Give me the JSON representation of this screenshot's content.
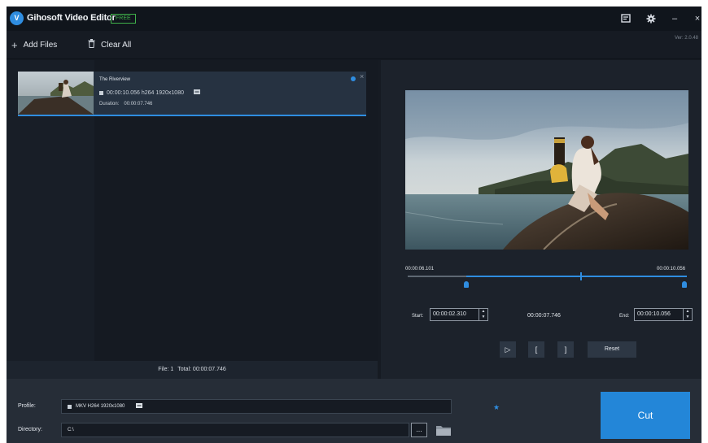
{
  "app": {
    "logo_letter": "V",
    "title": "Gihosoft Video Editor",
    "badge": "FREE",
    "version": "Ver: 2.0.48"
  },
  "window_controls": {
    "icons": [
      "feedback-icon",
      "settings-gear-icon",
      "minimize-icon",
      "close-icon"
    ],
    "minimize": "–",
    "close": "×"
  },
  "toolbar": {
    "add_files_label": "Add Files",
    "add_files_icon": "plus-icon",
    "clear_all_label": "Clear All",
    "clear_all_icon": "trash-icon"
  },
  "files": [
    {
      "name": "The Riverview",
      "info": "00:00:10.056 h264 1920x1080",
      "duration_label": "Duration:",
      "duration": "00:00:07.746"
    }
  ],
  "file_status": {
    "count": "File: 1",
    "total": "Total: 00:00:07.746"
  },
  "timeline": {
    "start_time": "00:00:06.101",
    "end_time": "00:00:10.056",
    "selection_start_fraction": 0.21,
    "selection_end_fraction": 1.0,
    "playhead_fraction": 0.62
  },
  "trim": {
    "start_label": "Start:",
    "start_value": "00:00:02.310",
    "duration": "00:00:07.746",
    "end_label": "End:",
    "end_value": "00:00:10.056",
    "spin_up": "▲",
    "spin_down": "▼"
  },
  "controls": {
    "play": "▷",
    "mark_in": "[",
    "mark_out": "]",
    "reset": "Reset"
  },
  "output": {
    "profile_label": "Profile:",
    "profile_value": "MKV H264 1920x1080",
    "directory_label": "Directory:",
    "directory_value": "C:\\",
    "browse": "...",
    "cut_label": "Cut"
  },
  "colors": {
    "accent": "#2f8de0",
    "free_badge": "#3fb04a",
    "cut_button": "#2386d8",
    "background": "#161b23"
  }
}
